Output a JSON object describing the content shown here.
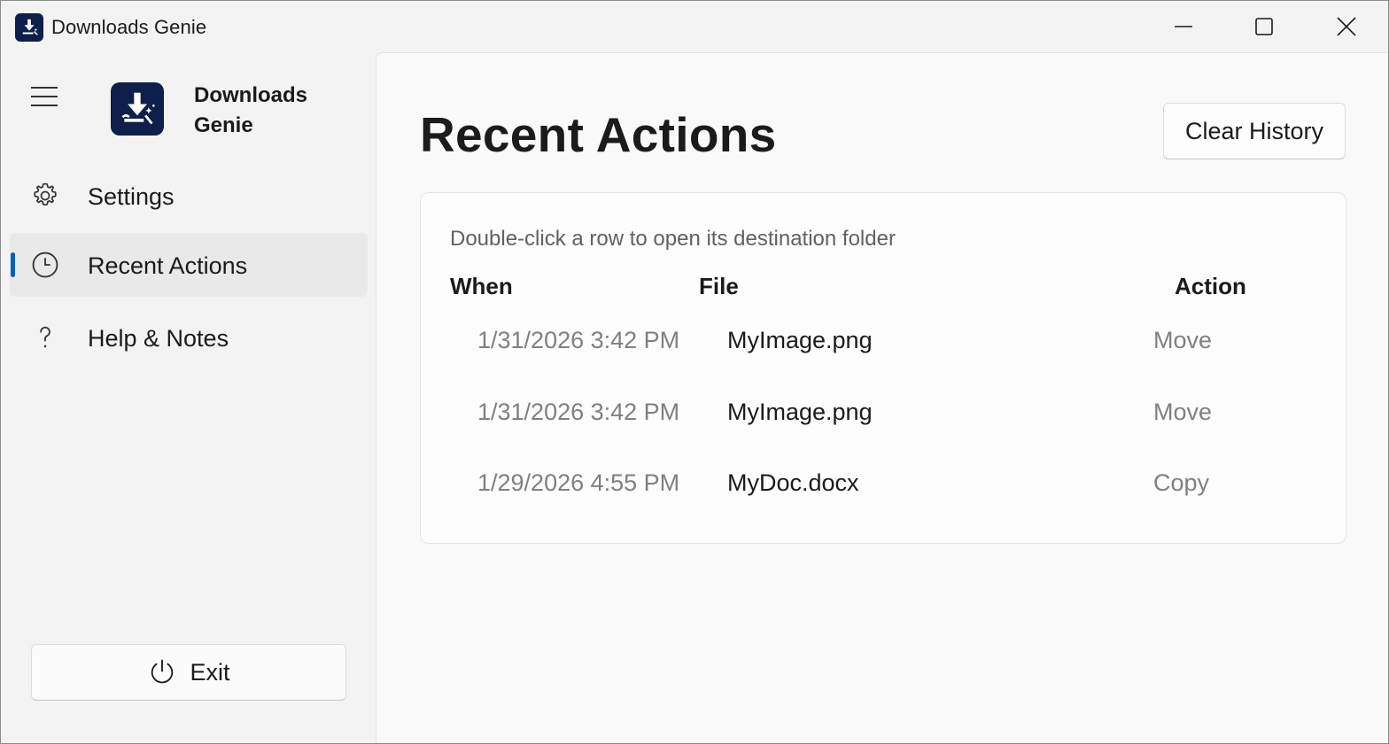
{
  "window": {
    "title": "Downloads Genie",
    "accent_color": "#0060c0",
    "icon_bg": "#0d1f4a"
  },
  "sidebar": {
    "app_name": "Downloads Genie",
    "items": [
      {
        "label": "Settings",
        "icon": "gear-icon",
        "active": false
      },
      {
        "label": "Recent Actions",
        "icon": "clock-icon",
        "active": true
      },
      {
        "label": "Help & Notes",
        "icon": "question-icon",
        "active": false
      }
    ],
    "exit_label": "Exit"
  },
  "main": {
    "title": "Recent Actions",
    "clear_button_label": "Clear History",
    "hint": "Double-click a row to open its destination folder",
    "columns": [
      "When",
      "File",
      "Action"
    ],
    "rows": [
      {
        "when": "1/31/2026 3:42 PM",
        "file": "MyImage.png",
        "action": "Move"
      },
      {
        "when": "1/31/2026 3:42 PM",
        "file": "MyImage.png",
        "action": "Move"
      },
      {
        "when": "1/29/2026 4:55 PM",
        "file": "MyDoc.docx",
        "action": "Copy"
      }
    ]
  }
}
